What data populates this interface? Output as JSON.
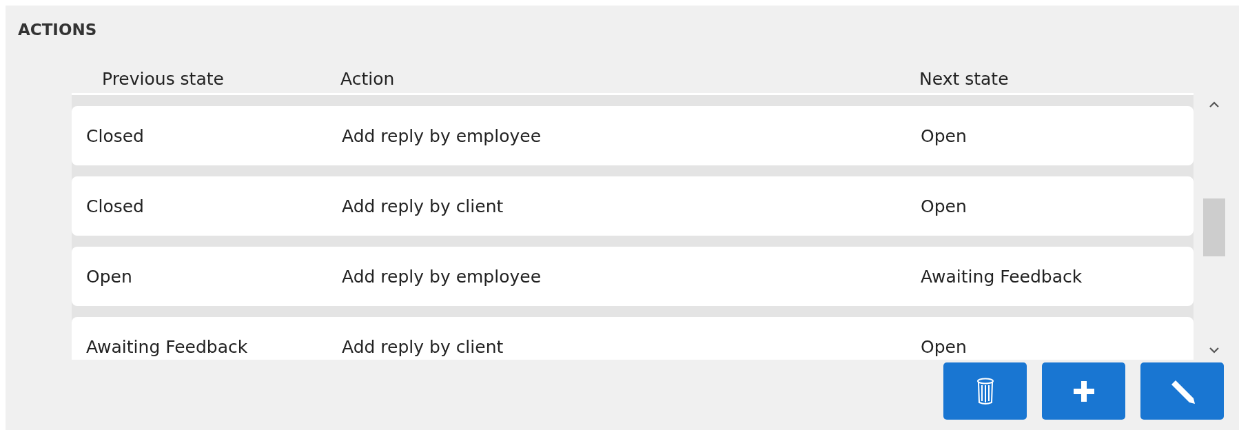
{
  "section_title": "ACTIONS",
  "table": {
    "columns": [
      "Previous state",
      "Action",
      "Next state"
    ],
    "rows": [
      {
        "cells": [
          "Closed",
          "Add reply by employee",
          "Open"
        ]
      },
      {
        "cells": [
          "Closed",
          "Add reply by client",
          "Open"
        ]
      },
      {
        "cells": [
          "Open",
          "Add reply by employee",
          "Awaiting Feedback"
        ]
      },
      {
        "cells": [
          "Awaiting Feedback",
          "Add reply by client",
          "Open"
        ]
      }
    ]
  },
  "buttons": [
    {
      "kind": "delete"
    },
    {
      "kind": "add"
    },
    {
      "kind": "edit"
    }
  ]
}
